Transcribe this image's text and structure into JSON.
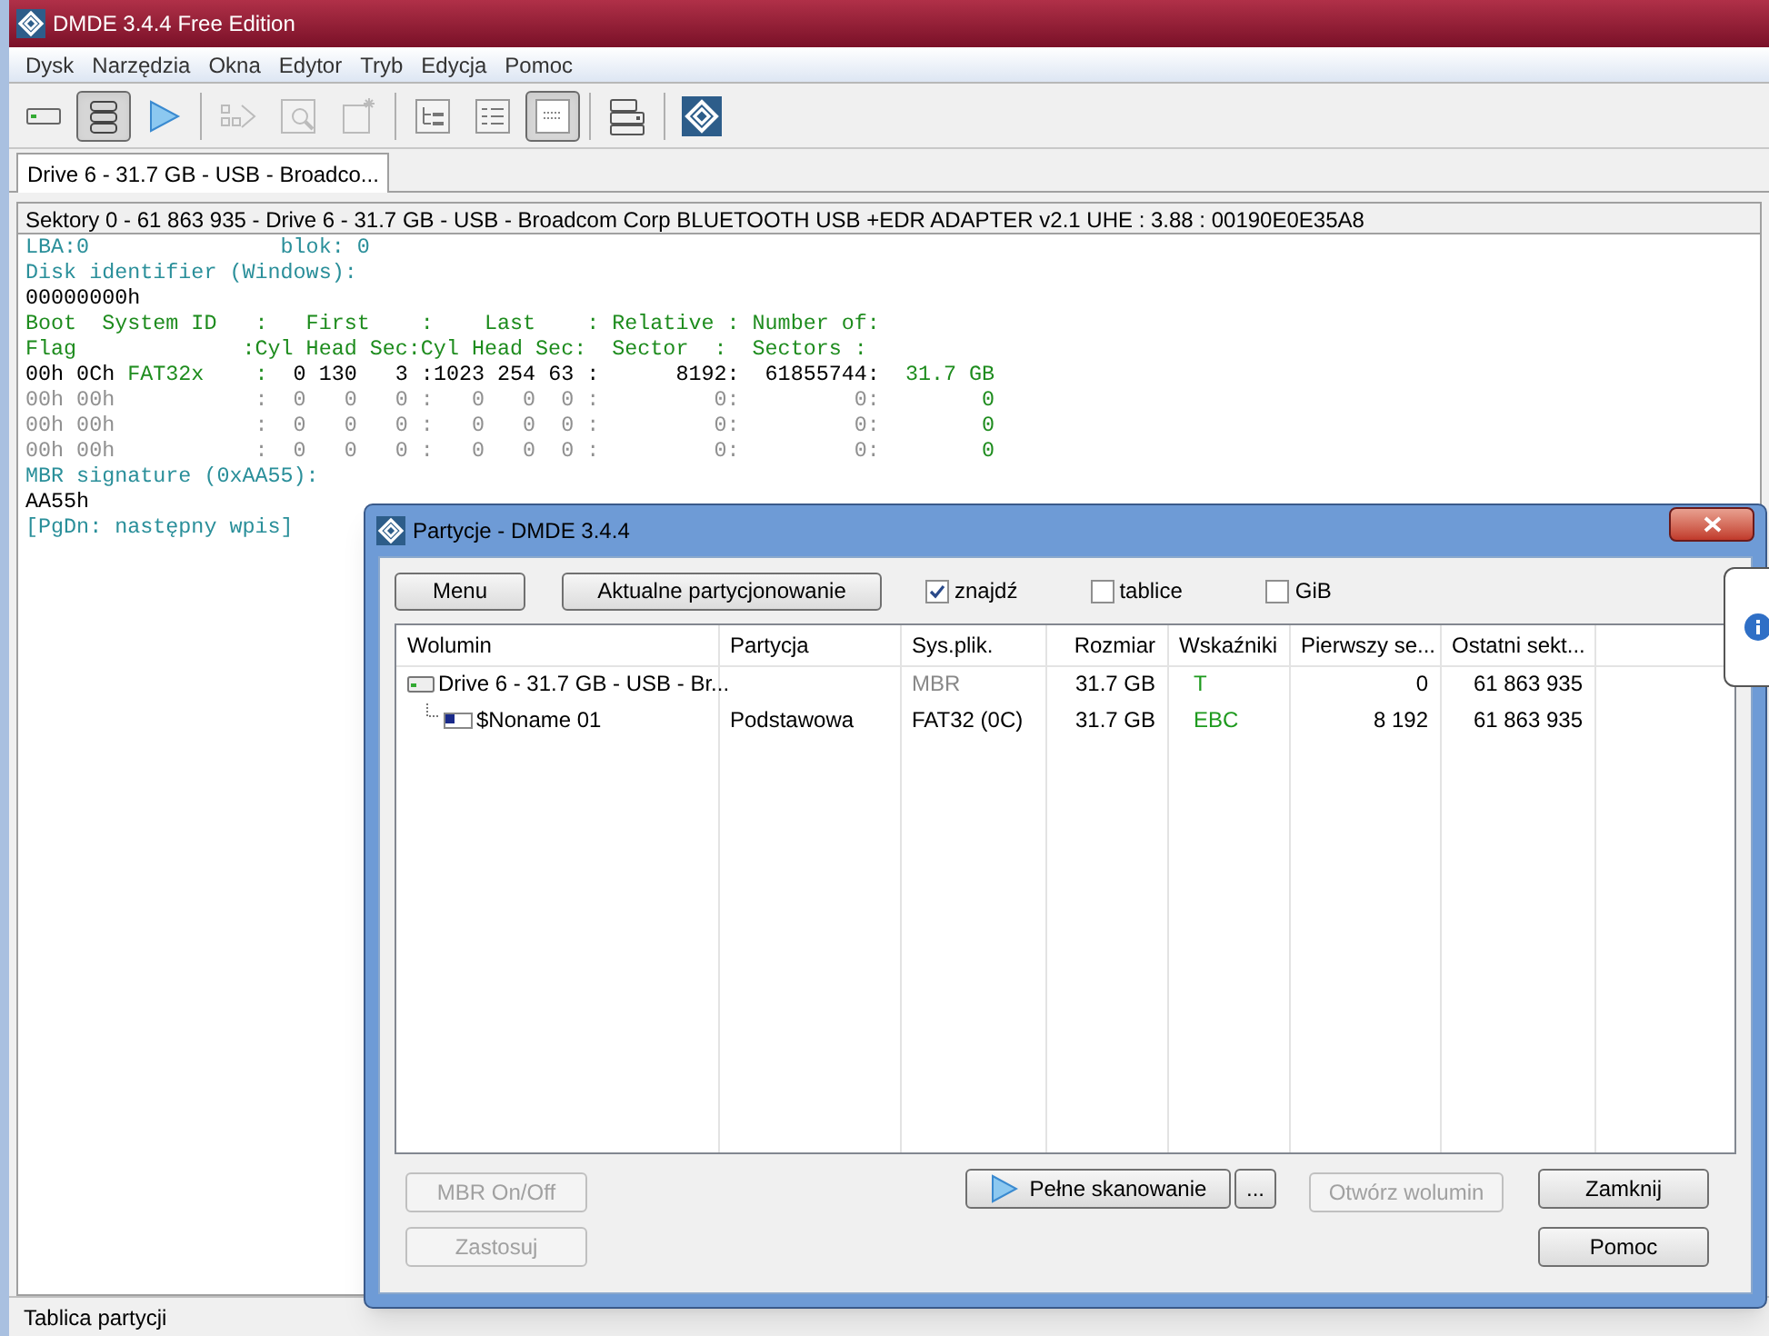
{
  "window": {
    "title": "DMDE 3.4.4 Free Edition"
  },
  "menu": [
    "Dysk",
    "Narzędzia",
    "Okna",
    "Edytor",
    "Tryb",
    "Edycja",
    "Pomoc"
  ],
  "toolbar": [
    {
      "kind": "drive",
      "pressed": false,
      "disabled": false
    },
    {
      "kind": "list",
      "pressed": true,
      "disabled": false
    },
    {
      "kind": "play",
      "pressed": false,
      "disabled": false
    },
    {
      "kind": "step",
      "pressed": false,
      "disabled": true
    },
    {
      "kind": "find",
      "pressed": false,
      "disabled": true
    },
    {
      "kind": "new",
      "pressed": false,
      "disabled": true
    },
    {
      "kind": "tree",
      "pressed": false,
      "disabled": false
    },
    {
      "kind": "details",
      "pressed": false,
      "disabled": false
    },
    {
      "kind": "grid",
      "pressed": true,
      "disabled": false
    },
    {
      "kind": "records",
      "pressed": false,
      "disabled": false
    },
    {
      "kind": "logo",
      "pressed": false,
      "disabled": false
    }
  ],
  "tabs": [
    {
      "label": "Drive 6 - 31.7 GB - USB - Broadco...",
      "selected": true
    }
  ],
  "panel_header": "Sektory 0 - 61 863 935 - Drive 6 - 31.7 GB - USB - Broadcom Corp BLUETOOTH USB +EDR ADAPTER v2.1 UHE : 3.88 : 00190E0E35A8",
  "dump_lines": [
    [
      {
        "text": "LBA:0               blok: 0",
        "kind": "label"
      }
    ],
    [
      {
        "text": "Disk identifier (Windows):",
        "kind": "label"
      }
    ],
    [
      {
        "text": "00000000h",
        "kind": "value"
      }
    ],
    [
      {
        "text": "Boot  System ID   :   First    :    Last    : Relative : Number of:",
        "kind": "field"
      }
    ],
    [
      {
        "text": "Flag             :Cyl Head Sec:Cyl Head Sec:  Sector  :  Sectors :",
        "kind": "field"
      }
    ],
    [
      {
        "text": "00h 0Ch ",
        "kind": "value"
      },
      {
        "text": "FAT32x    :",
        "kind": "field"
      },
      {
        "text": "  0 130   3 :1023 254 63 :      8192:  61855744:",
        "kind": "value"
      },
      {
        "text": "  31.7 GB",
        "kind": "field"
      }
    ],
    [
      {
        "text": "00h 00h           :  0   0   0 :   0   0  0 :         0:         0:",
        "kind": "empty"
      },
      {
        "text": "        0",
        "kind": "field"
      }
    ],
    [
      {
        "text": "00h 00h           :  0   0   0 :   0   0  0 :         0:         0:",
        "kind": "empty"
      },
      {
        "text": "        0",
        "kind": "field"
      }
    ],
    [
      {
        "text": "00h 00h           :  0   0   0 :   0   0  0 :         0:         0:",
        "kind": "empty"
      },
      {
        "text": "        0",
        "kind": "field"
      }
    ],
    [
      {
        "text": "MBR signature (0xAA55):",
        "kind": "label"
      }
    ],
    [
      {
        "text": "AA55h",
        "kind": "value"
      }
    ],
    [
      {
        "text": "[PgDn: następny wpis]",
        "kind": "label"
      }
    ]
  ],
  "status_bar": "Tablica partycji",
  "dialog": {
    "title": "Partycje - DMDE 3.4.4",
    "buttons": [
      {
        "label": "Menu"
      },
      {
        "label": "Aktualne partycjonowanie"
      }
    ],
    "checkboxes": [
      {
        "label": "znajdź",
        "checked": true
      },
      {
        "label": "tablice",
        "checked": false
      },
      {
        "label": "GiB",
        "checked": false
      }
    ],
    "table": {
      "columns": [
        "Wolumin",
        "Partycja",
        "Sys.plik.",
        "Rozmiar",
        "Wskaźniki",
        "Pierwszy se...",
        "Ostatni sekt..."
      ],
      "rows": [
        {
          "kind": "disk",
          "cells": [
            "Drive 6 - 31.7 GB - USB - Br...",
            "",
            "MBR",
            "31.7 GB",
            "T",
            "0",
            "61 863 935"
          ],
          "children": [
            {
              "kind": "partition",
              "cells": [
                "$Noname 01",
                "Podstawowa",
                "FAT32 (0C)",
                "31.7 GB",
                "EBC",
                "8 192",
                "61 863 935"
              ]
            }
          ]
        }
      ]
    },
    "bottom_buttons": [
      {
        "label": "MBR On/Off",
        "disabled": true
      },
      {
        "label": "Zastosuj",
        "disabled": true
      },
      {
        "label": "Pełne skanowanie",
        "disabled": false
      },
      {
        "label": "...",
        "disabled": false
      },
      {
        "label": "Otwórz wolumin",
        "disabled": true
      },
      {
        "label": "Zamknij",
        "disabled": false
      },
      {
        "label": "Pomoc",
        "disabled": false
      }
    ]
  }
}
